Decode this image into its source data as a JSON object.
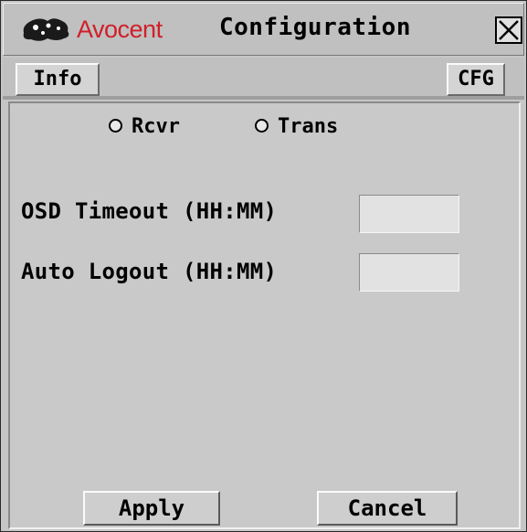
{
  "window": {
    "brand": "Avocent",
    "title": "Configuration",
    "close_icon": "close-x-icon",
    "logo_icon": "avocent-logo-icon",
    "brand_color": "#d0202a"
  },
  "tabs": [
    {
      "label": "Info"
    },
    {
      "label": "CFG"
    }
  ],
  "mode": {
    "options": [
      {
        "label": "Rcvr",
        "selected": false
      },
      {
        "label": "Trans",
        "selected": false
      }
    ]
  },
  "fields": [
    {
      "label": "OSD Timeout (HH:MM)",
      "value": ""
    },
    {
      "label": "Auto Logout (HH:MM)",
      "value": ""
    }
  ],
  "buttons": {
    "apply": "Apply",
    "cancel": "Cancel"
  }
}
